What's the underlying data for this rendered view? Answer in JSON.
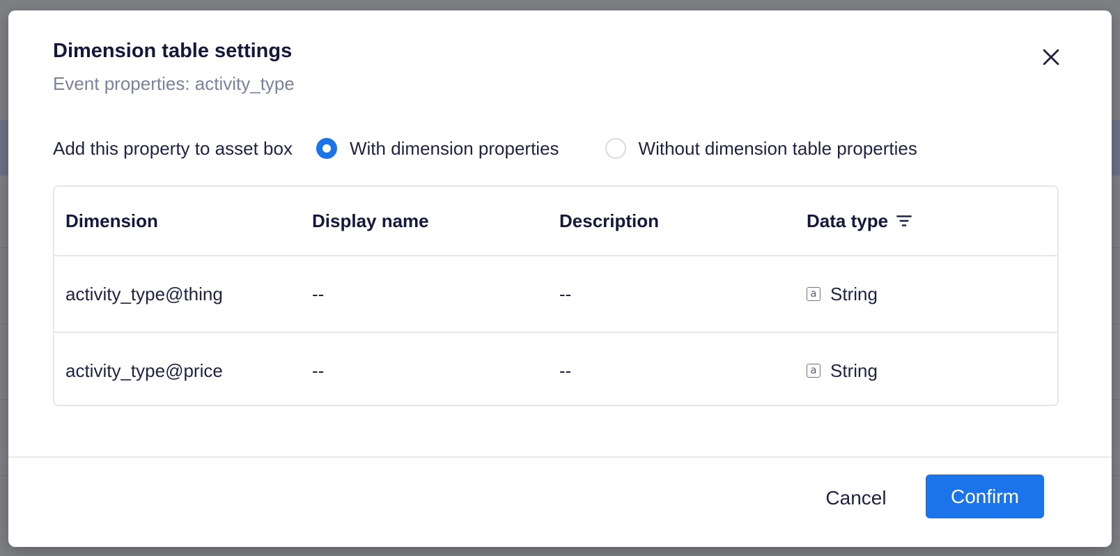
{
  "dialog": {
    "title": "Dimension table settings",
    "subtitle": "Event properties: activity_type",
    "close_icon": "close-icon"
  },
  "options": {
    "label": "Add this property to asset box",
    "choices": [
      {
        "label": "With dimension properties",
        "selected": true
      },
      {
        "label": "Without dimension table properties",
        "selected": false
      }
    ]
  },
  "table": {
    "columns": [
      "Dimension",
      "Display name",
      "Description",
      "Data type"
    ],
    "rows": [
      {
        "dimension": "activity_type@thing",
        "display_name": "--",
        "description": "--",
        "data_type": "String",
        "type_icon": "a"
      },
      {
        "dimension": "activity_type@price",
        "display_name": "--",
        "description": "--",
        "data_type": "String",
        "type_icon": "a"
      }
    ]
  },
  "footer": {
    "cancel_label": "Cancel",
    "confirm_label": "Confirm"
  },
  "colors": {
    "accent": "#1c74ea",
    "overlay": "#8a8a8f",
    "muted_text": "#7a8399"
  }
}
